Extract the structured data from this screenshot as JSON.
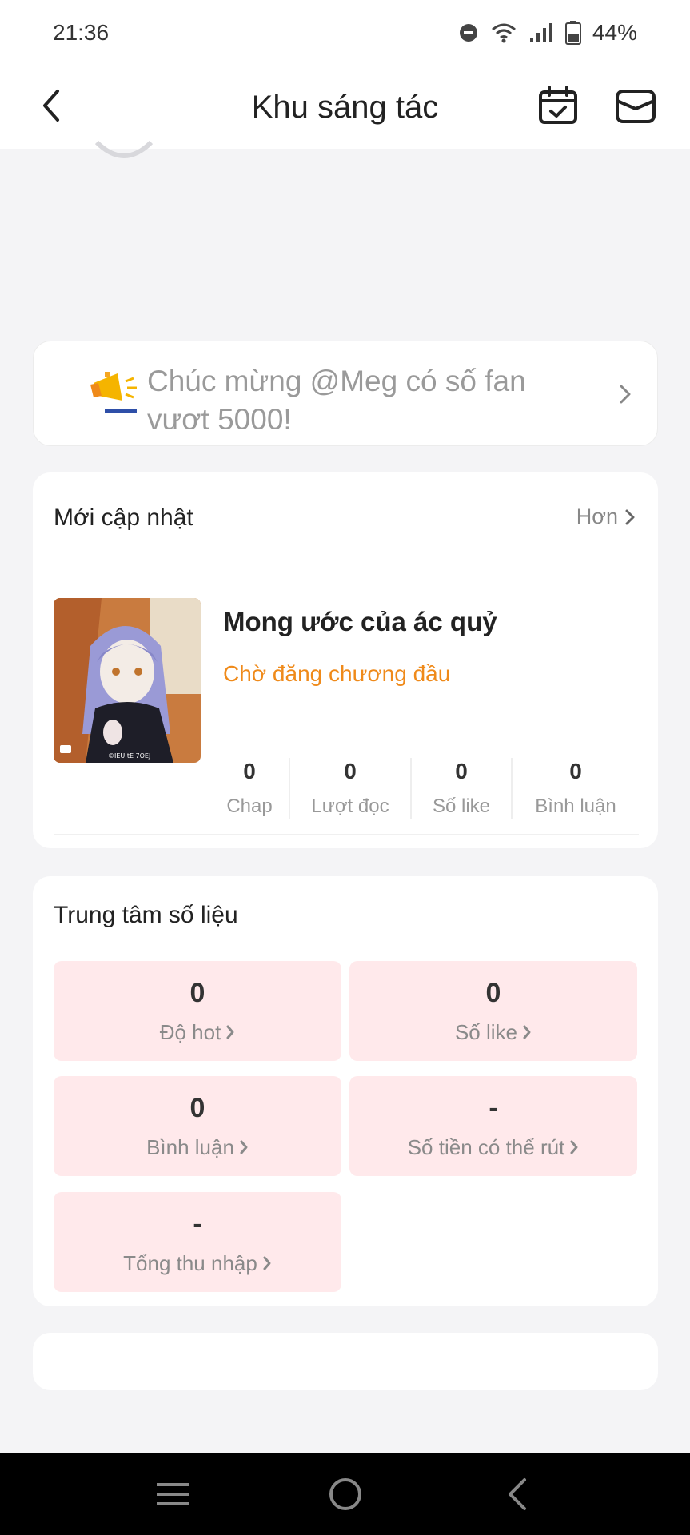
{
  "status_bar": {
    "time": "21:36",
    "battery": "44%"
  },
  "app_bar": {
    "title": "Khu sáng tác"
  },
  "notice": {
    "text": "Chúc mừng @Meg có số fan vượt 5000!"
  },
  "updates": {
    "title": "Mới cập nhật",
    "more_label": "Hơn",
    "work": {
      "title": "Mong ước của ác quỷ",
      "status": "Chờ đăng chương đầu",
      "stats": [
        {
          "value": "0",
          "label": "Chap"
        },
        {
          "value": "0",
          "label": "Lượt đọc"
        },
        {
          "value": "0",
          "label": "Số like"
        },
        {
          "value": "0",
          "label": "Bình luận"
        }
      ]
    }
  },
  "data_center": {
    "title": "Trung tâm số liệu",
    "tiles": [
      {
        "value": "0",
        "label": "Độ hot"
      },
      {
        "value": "0",
        "label": "Số like"
      },
      {
        "value": "0",
        "label": "Bình luận"
      },
      {
        "value": "-",
        "label": "Số tiền có thể rút"
      },
      {
        "value": "-",
        "label": "Tổng thu nhập"
      }
    ]
  },
  "colors": {
    "accent_orange": "#ef8a1a",
    "tile_pink": "#ffe9eb"
  }
}
